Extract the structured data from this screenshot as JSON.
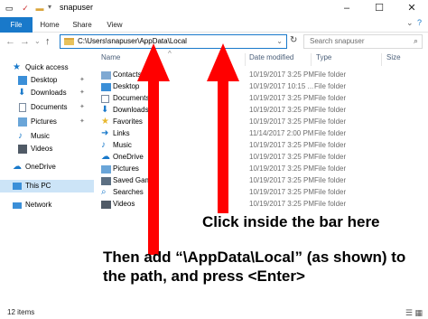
{
  "titlebar": {
    "title": "snapuser",
    "qa_icons": [
      "window-icon",
      "check-icon",
      "folder-icon"
    ],
    "buttons": {
      "minimize": "–",
      "maximize": "☐",
      "close": "✕"
    }
  },
  "ribbon": {
    "tabs": [
      "File",
      "Home",
      "Share",
      "View"
    ],
    "expand": "⌄",
    "help": "?"
  },
  "address": {
    "back": "←",
    "forward": "→",
    "recent": "⌄",
    "up": "↑",
    "path": "C:\\Users\\snapuser\\AppData\\Local",
    "dropdown": "⌄",
    "refresh": "↻",
    "search_placeholder": "Search snapuser",
    "search_icon": "⌕"
  },
  "nav": {
    "quick_access": "Quick access",
    "items": [
      {
        "label": "Desktop",
        "pinned": true
      },
      {
        "label": "Downloads",
        "pinned": true
      },
      {
        "label": "Documents",
        "pinned": true
      },
      {
        "label": "Pictures",
        "pinned": true
      },
      {
        "label": "Music",
        "pinned": false
      },
      {
        "label": "Videos",
        "pinned": false
      }
    ],
    "onedrive": "OneDrive",
    "thispc": "This PC",
    "network": "Network",
    "pin_glyph": "📌"
  },
  "list": {
    "columns": {
      "name": "Name",
      "date": "Date modified",
      "type": "Type",
      "size": "Size"
    },
    "sort_glyph": "^",
    "rows": [
      {
        "name": "Contacts",
        "date": "10/19/2017 3:25 PM",
        "type": "File folder",
        "icon": "contacts-icon"
      },
      {
        "name": "Desktop",
        "date": "10/19/2017 10:15 ...",
        "type": "File folder",
        "icon": "desktop-icon"
      },
      {
        "name": "Documents",
        "date": "10/19/2017 3:25 PM",
        "type": "File folder",
        "icon": "documents-icon"
      },
      {
        "name": "Downloads",
        "date": "10/19/2017 3:25 PM",
        "type": "File folder",
        "icon": "downloads-icon"
      },
      {
        "name": "Favorites",
        "date": "10/19/2017 3:25 PM",
        "type": "File folder",
        "icon": "favorites-icon"
      },
      {
        "name": "Links",
        "date": "11/14/2017 2:00 PM",
        "type": "File folder",
        "icon": "links-icon"
      },
      {
        "name": "Music",
        "date": "10/19/2017 3:25 PM",
        "type": "File folder",
        "icon": "music-icon"
      },
      {
        "name": "OneDrive",
        "date": "10/19/2017 3:25 PM",
        "type": "File folder",
        "icon": "onedrive-icon"
      },
      {
        "name": "Pictures",
        "date": "10/19/2017 3:25 PM",
        "type": "File folder",
        "icon": "pictures-icon"
      },
      {
        "name": "Saved Games",
        "date": "10/19/2017 3:25 PM",
        "type": "File folder",
        "icon": "saved-games-icon"
      },
      {
        "name": "Searches",
        "date": "10/19/2017 3:25 PM",
        "type": "File folder",
        "icon": "searches-icon"
      },
      {
        "name": "Videos",
        "date": "10/19/2017 3:25 PM",
        "type": "File folder",
        "icon": "videos-icon"
      }
    ]
  },
  "status": {
    "count": "12 items",
    "view_icons": "☰ ▦"
  },
  "annotations": {
    "instruction1": "Click inside the bar here",
    "instruction2": "Then add “\\AppData\\Local” (as shown) to the path, and press <Enter>"
  },
  "colors": {
    "accent": "#1979ca",
    "arrow": "#ff0000",
    "folder": "#e8c25c"
  }
}
